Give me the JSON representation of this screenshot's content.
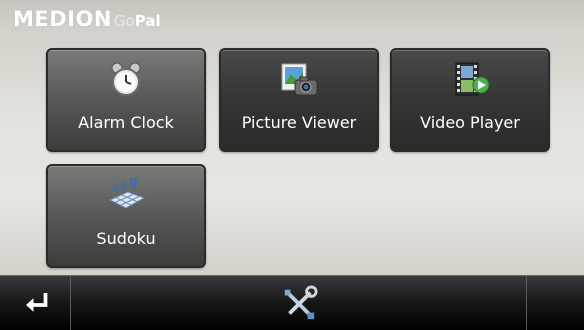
{
  "header": {
    "brand_main": "MEDION",
    "brand_sub_prefix": "Go",
    "brand_sub_suffix": "Pal"
  },
  "tiles": [
    {
      "label": "Alarm Clock",
      "icon": "alarm-clock-icon"
    },
    {
      "label": "Picture Viewer",
      "icon": "picture-viewer-icon"
    },
    {
      "label": "Video Player",
      "icon": "video-player-icon"
    },
    {
      "label": "Sudoku",
      "icon": "sudoku-icon"
    }
  ],
  "bottombar": {
    "back_icon": "back-arrow-icon",
    "tools_icon": "tools-icon"
  },
  "colors": {
    "tile_dark": "#363635",
    "tile_light": "#5b5b59",
    "accent_blue": "#3b87c8",
    "accent_green": "#4caf50"
  }
}
